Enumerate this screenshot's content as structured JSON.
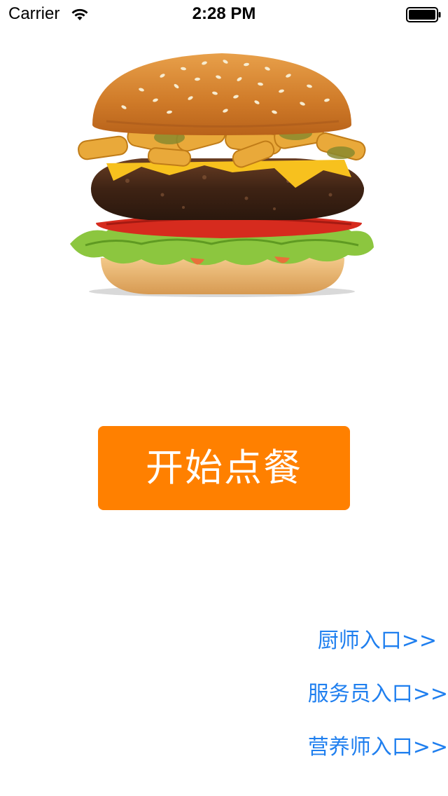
{
  "status_bar": {
    "carrier": "Carrier",
    "time": "2:28 PM",
    "wifi_icon": "wifi-icon",
    "battery_icon": "battery-icon"
  },
  "hero": {
    "image": "hamburger-illustration"
  },
  "main": {
    "start_button_label": "开始点餐",
    "start_button_color": "#ff8000"
  },
  "entries": {
    "chef": "厨师入口>>",
    "waiter": "服务员入口>>",
    "nutritionist": "营养师入口>>",
    "link_color": "#1f7fef"
  }
}
